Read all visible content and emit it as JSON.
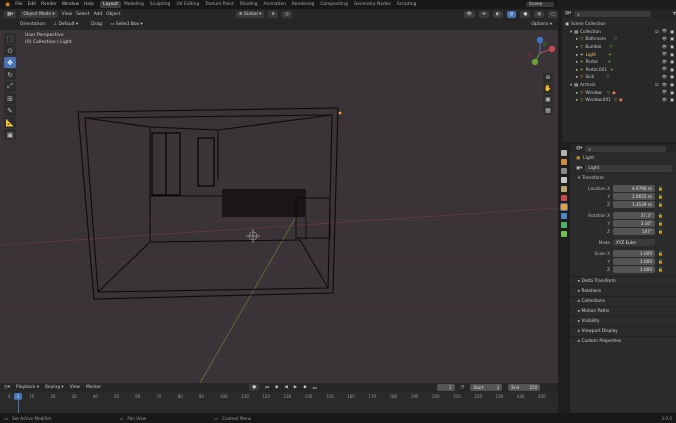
{
  "menu": [
    "File",
    "Edit",
    "Render",
    "Window",
    "Help"
  ],
  "workspaces": [
    "Layout",
    "Modeling",
    "Sculpting",
    "UV Editing",
    "Texture Paint",
    "Shading",
    "Animation",
    "Rendering",
    "Compositing",
    "Geometry Nodes",
    "Scripting"
  ],
  "active_workspace": "Layout",
  "scene_name": "Scene",
  "view_layer": "ViewLayer",
  "header": {
    "mode": "Object Mode",
    "view": "View",
    "select": "Select",
    "add": "Add",
    "object": "Object",
    "transform_orientation": "Global"
  },
  "header2": {
    "orientation_label": "Orientation:",
    "orientation_value": "Default",
    "drag_label": "Drag:",
    "drag_value": "Select Box",
    "options": "Options"
  },
  "viewport": {
    "perspective": "User Perspective",
    "collection_info": "(0) Collection | Light"
  },
  "outliner": {
    "root": "Scene Collection",
    "items": [
      {
        "name": "Collection",
        "level": 1
      },
      {
        "name": "Bathroom",
        "level": 2
      },
      {
        "name": "Bumbie",
        "level": 2
      },
      {
        "name": "Light",
        "level": 2
      },
      {
        "name": "Portal",
        "level": 2
      },
      {
        "name": "Portal.001",
        "level": 2
      },
      {
        "name": "Sink",
        "level": 2
      },
      {
        "name": "Archviz",
        "level": 1
      },
      {
        "name": "Window",
        "level": 2
      },
      {
        "name": "Window.001",
        "level": 2
      }
    ]
  },
  "properties": {
    "object_name": "Light",
    "data_name": "Light",
    "transform_label": "Transform",
    "location": {
      "label": "Location X",
      "x": "4.9766 m",
      "y": "1.0655 m",
      "z": "1.3539 m"
    },
    "rotation": {
      "label": "Rotation X",
      "x": "37.3°",
      "y": "3.16°",
      "z": "107°"
    },
    "mode_label": "Mode",
    "mode_value": "XYZ Euler",
    "scale": {
      "label": "Scale X",
      "x": "1.000",
      "y": "1.000",
      "z": "1.000"
    },
    "sections": [
      "Delta Transform",
      "Relations",
      "Collections",
      "Motion Paths",
      "Visibility",
      "Viewport Display",
      "Custom Properties"
    ]
  },
  "timeline": {
    "menu": [
      "Playback",
      "Keying",
      "View",
      "Marker"
    ],
    "current_frame": "1",
    "start_label": "Start",
    "start": "1",
    "end_label": "End",
    "end": "250",
    "ticks": [
      "0",
      "10",
      "20",
      "30",
      "40",
      "50",
      "60",
      "70",
      "80",
      "90",
      "100",
      "110",
      "120",
      "130",
      "140",
      "150",
      "160",
      "170",
      "180",
      "190",
      "200",
      "210",
      "220",
      "230",
      "240",
      "250"
    ]
  },
  "status": {
    "left": "Set Active Modifier",
    "mid": "Pan View",
    "right": "Context Menu",
    "version": "3.0.0"
  },
  "colors": {
    "accent": "#4772b3",
    "viewport_bg": "#3a3337",
    "light_icon": "#f0c36b"
  }
}
